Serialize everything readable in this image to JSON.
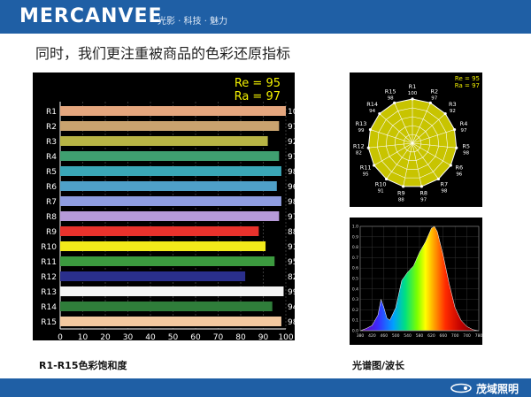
{
  "header": {
    "brand": "MERCANVEE",
    "tagline": "光影 · 科技 · 魅力"
  },
  "slide": {
    "heading": "同时，我们更注重被商品的色彩还原指标",
    "caption_bars": "R1-R15色彩饱和度",
    "caption_spectrum": "光谱图/波长"
  },
  "footer": {
    "logo_text": "茂域照明",
    "colors": {
      "bar": "#1f5fa5"
    }
  },
  "chart_data": [
    {
      "type": "bar",
      "orientation": "horizontal",
      "re_label": "Re = 95",
      "ra_label": "Ra = 97",
      "categories": [
        "R1",
        "R2",
        "R3",
        "R4",
        "R5",
        "R6",
        "R7",
        "R8",
        "R9",
        "R10",
        "R11",
        "R12",
        "R13",
        "R14",
        "R15"
      ],
      "values": [
        100,
        97,
        92,
        97,
        98,
        96,
        98,
        97,
        88,
        91,
        95,
        82,
        99,
        94,
        98
      ],
      "colors": [
        "#e4a67e",
        "#c9a36f",
        "#b8b445",
        "#3f9f70",
        "#3aa7b7",
        "#4fa0c8",
        "#8f9de0",
        "#b69ad8",
        "#e8322c",
        "#f2ea1a",
        "#3c9a3f",
        "#2a2f8c",
        "#f4f4f4",
        "#2f7d3a",
        "#f3c9a0"
      ],
      "xticks": [
        "0",
        "10",
        "20",
        "30",
        "40",
        "50",
        "60",
        "70",
        "80",
        "90",
        "100"
      ],
      "xlim": [
        0,
        100
      ]
    },
    {
      "type": "radar",
      "legend": [
        "Re = 95",
        "Ra = 97"
      ],
      "axes": [
        {
          "label": "R1",
          "value": "100"
        },
        {
          "label": "R2",
          "value": "97"
        },
        {
          "label": "R3",
          "value": "92"
        },
        {
          "label": "R4",
          "value": "97"
        },
        {
          "label": "R5",
          "value": "98"
        },
        {
          "label": "R6",
          "value": "96"
        },
        {
          "label": "R7",
          "value": "98"
        },
        {
          "label": "R8",
          "value": "97"
        },
        {
          "label": "R9",
          "value": "88"
        },
        {
          "label": "R10",
          "value": "91"
        },
        {
          "label": "R11",
          "value": "95"
        },
        {
          "label": "R12",
          "value": "82"
        },
        {
          "label": "R13",
          "value": "99"
        },
        {
          "label": "R14",
          "value": "94"
        },
        {
          "label": "R15",
          "value": "98"
        }
      ]
    },
    {
      "type": "area",
      "x": [
        380,
        400,
        420,
        440,
        450,
        460,
        470,
        480,
        500,
        520,
        540,
        560,
        580,
        600,
        620,
        630,
        640,
        660,
        680,
        700,
        720,
        740,
        760,
        780
      ],
      "y": [
        0.0,
        0.02,
        0.05,
        0.15,
        0.3,
        0.22,
        0.12,
        0.1,
        0.22,
        0.48,
        0.56,
        0.62,
        0.75,
        0.85,
        0.98,
        1.0,
        0.95,
        0.72,
        0.45,
        0.22,
        0.1,
        0.04,
        0.01,
        0.0
      ],
      "xticks": [
        "380",
        "420",
        "460",
        "500",
        "540",
        "580",
        "620",
        "660",
        "700",
        "740",
        "780"
      ],
      "yticks": [
        "0.0",
        "0.1",
        "0.2",
        "0.3",
        "0.4",
        "0.5",
        "0.6",
        "0.7",
        "0.8",
        "0.9",
        "1.0"
      ],
      "xlim": [
        380,
        780
      ],
      "ylim": [
        0,
        1.0
      ]
    }
  ]
}
